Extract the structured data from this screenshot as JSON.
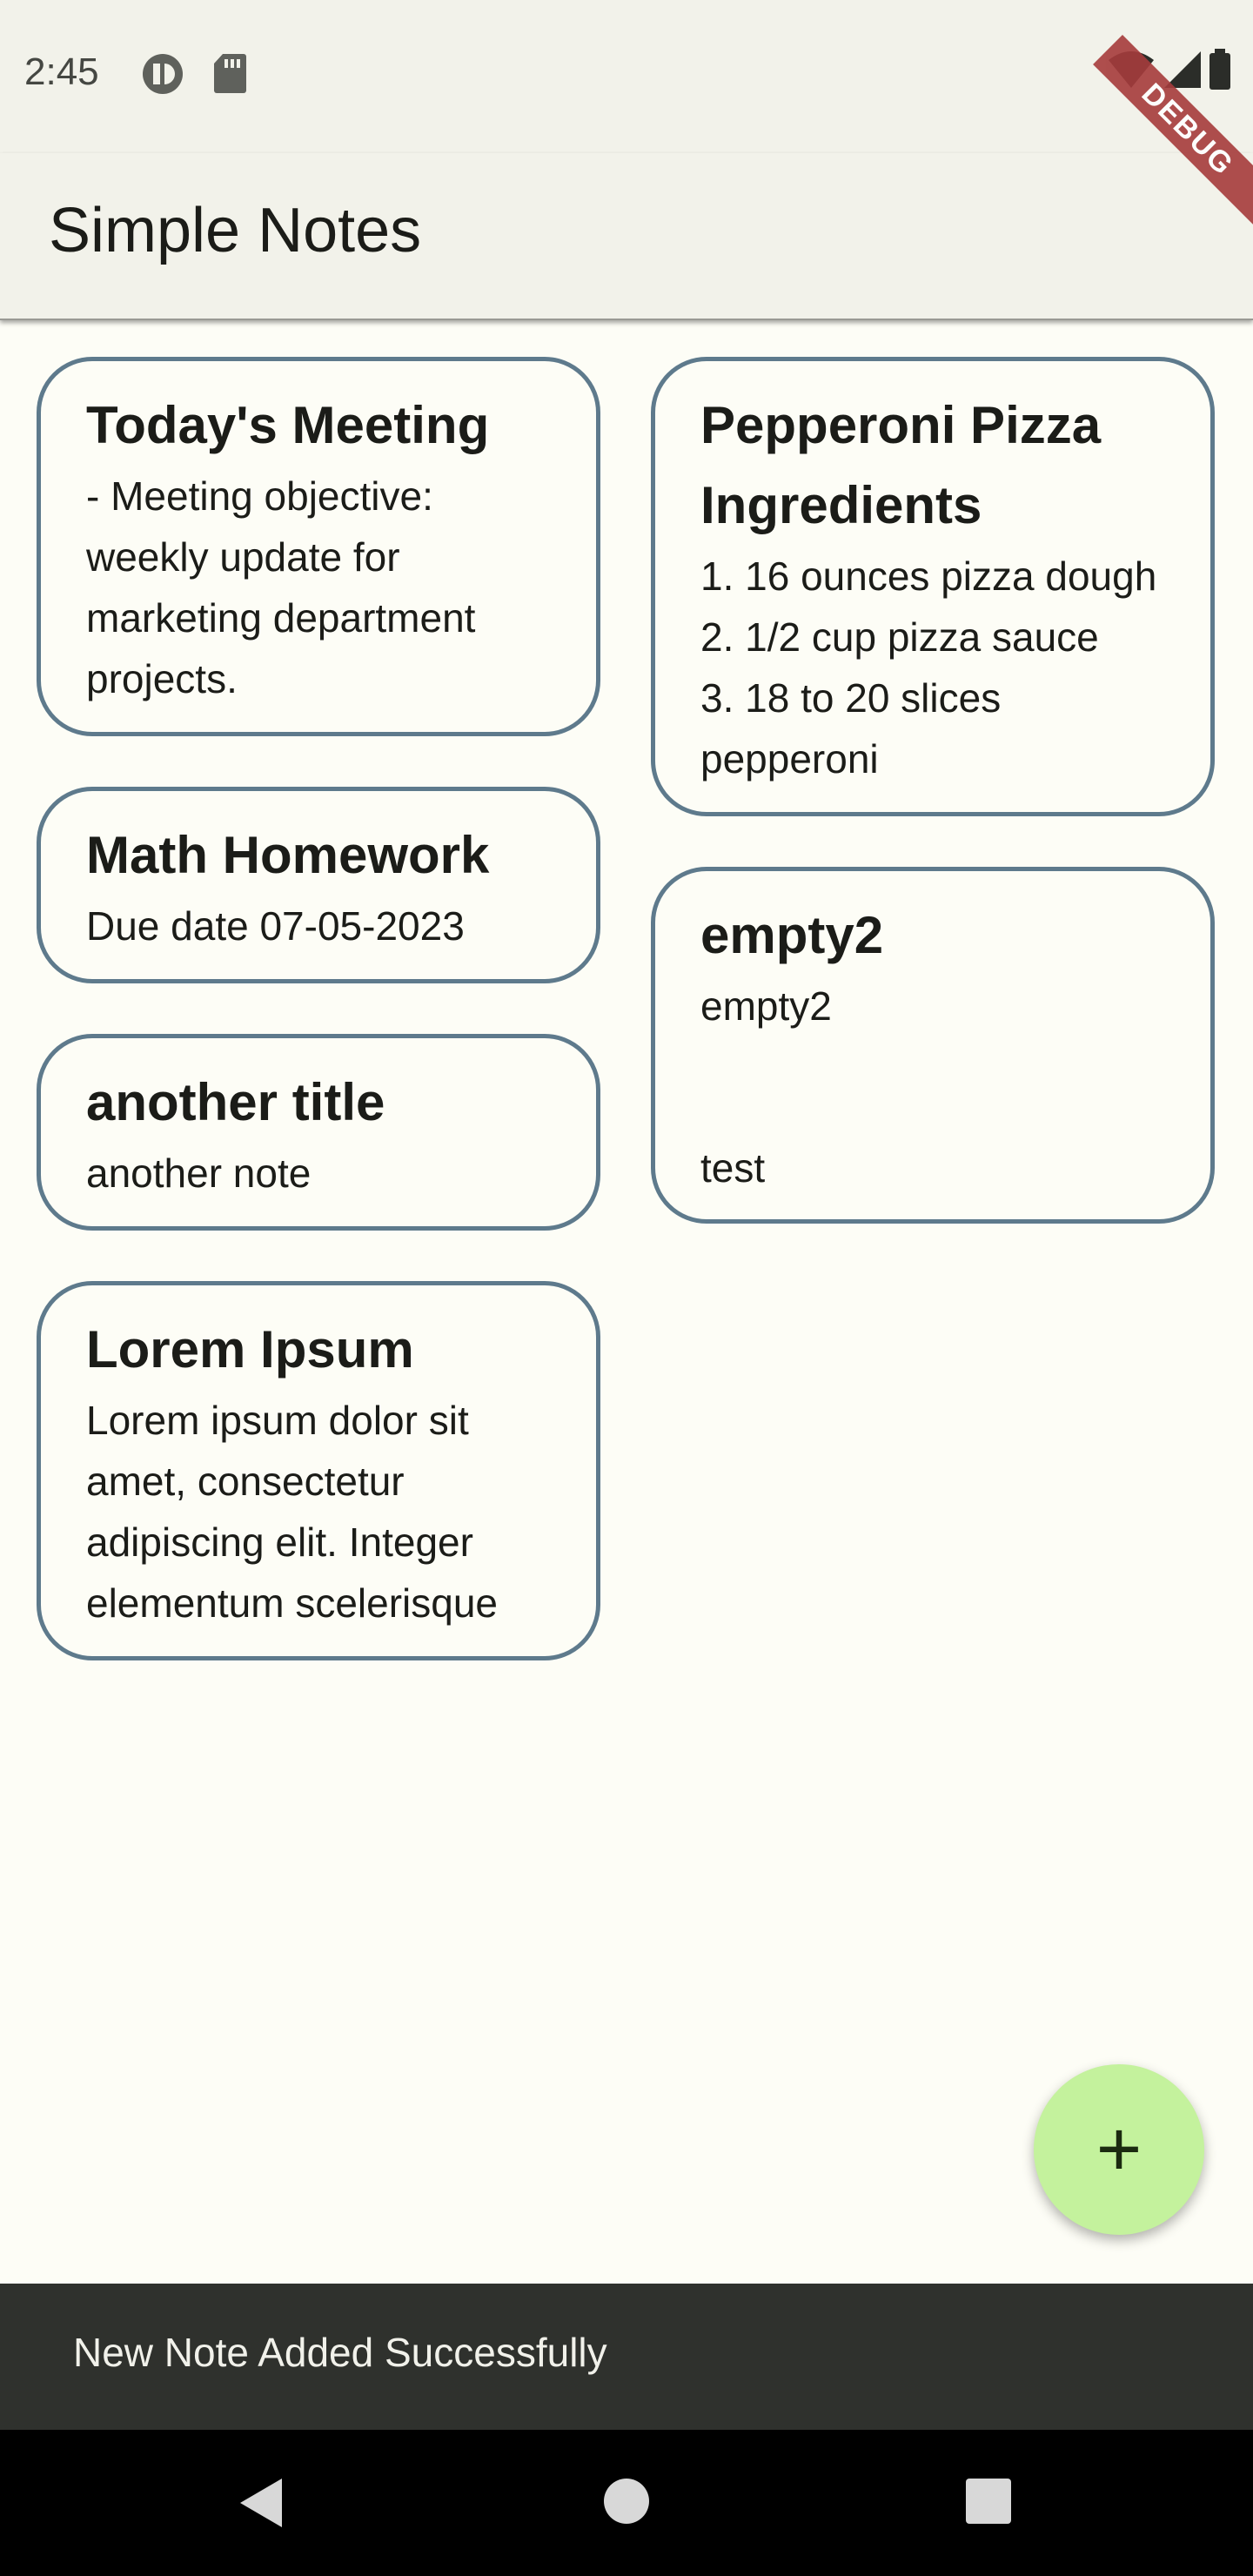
{
  "status_bar": {
    "time": "2:45",
    "left_icons": [
      "pause-circle-icon",
      "sd-card-icon"
    ],
    "right_icons": [
      "wifi-icon",
      "cell-signal-icon",
      "battery-icon"
    ]
  },
  "debug_banner": "DEBUG",
  "app_bar": {
    "title": "Simple Notes"
  },
  "notes": {
    "left": [
      {
        "title": "Today's Meeting",
        "body": "- Meeting objective: weekly update for marketing department projects."
      },
      {
        "title": "Math Homework",
        "body": "Due date 07-05-2023"
      },
      {
        "title": "another title",
        "body": "another note"
      },
      {
        "title": "Lorem Ipsum",
        "body": "Lorem ipsum dolor sit amet, consectetur adipiscing elit. Integer elementum scelerisque"
      }
    ],
    "right": [
      {
        "title": "Pepperoni Pizza Ingredients",
        "body": "1. 16 ounces pizza dough\n2. 1/2 cup pizza sauce\n3. 18 to 20 slices pepperoni"
      },
      {
        "title": "empty2",
        "body": "empty2",
        "footer": "test"
      }
    ]
  },
  "fab": {
    "icon": "plus-icon",
    "label": "+"
  },
  "snackbar": {
    "message": "New Note Added Successfully"
  },
  "nav": {
    "icons": [
      "back-icon",
      "home-icon",
      "recents-icon"
    ]
  },
  "colors": {
    "card_border": "#5e7a8c",
    "fab": "#c4f29d",
    "app_bar": "#f2f2ea",
    "background": "#fdfdf6"
  }
}
